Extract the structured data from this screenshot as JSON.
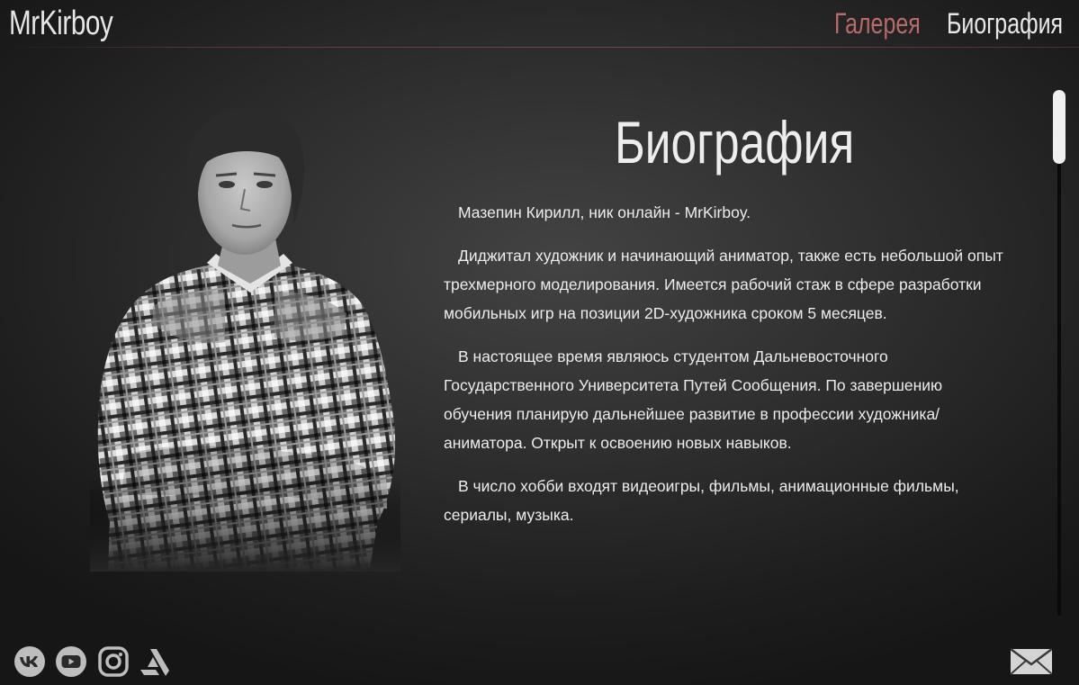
{
  "header": {
    "logo": "MrKirboy",
    "nav": [
      {
        "label": "Галерея",
        "active": false
      },
      {
        "label": "Биография",
        "active": true
      }
    ]
  },
  "bio": {
    "title": "Биография",
    "paragraphs": [
      "Мазепин Кирилл, ник онлайн - MrKirboy.",
      "Диджитал художник и начинающий аниматор, также есть небольшой опыт трехмерного моделирования. Имеется рабочий стаж в сфере разработки мобильных игр на позиции 2D-художника сроком 5 месяцев.",
      "В настоящее время являюсь студентом Дальневосточного Государственного Университета Путей Сообщения. По завершению обучения планирую дальнейшее развитие в профессии художника/аниматора. Открыт к освоению новых навыков.",
      "В число хобби входят видеоигры, фильмы, анимационные фильмы, сериалы, музыка."
    ]
  },
  "social": [
    {
      "name": "vk-icon"
    },
    {
      "name": "youtube-icon"
    },
    {
      "name": "instagram-icon"
    },
    {
      "name": "artstation-icon"
    }
  ],
  "contact": {
    "icon": "mail-icon"
  },
  "colors": {
    "accent": "#b86b6b",
    "text": "#ececec",
    "background": "#2e2e2e"
  }
}
